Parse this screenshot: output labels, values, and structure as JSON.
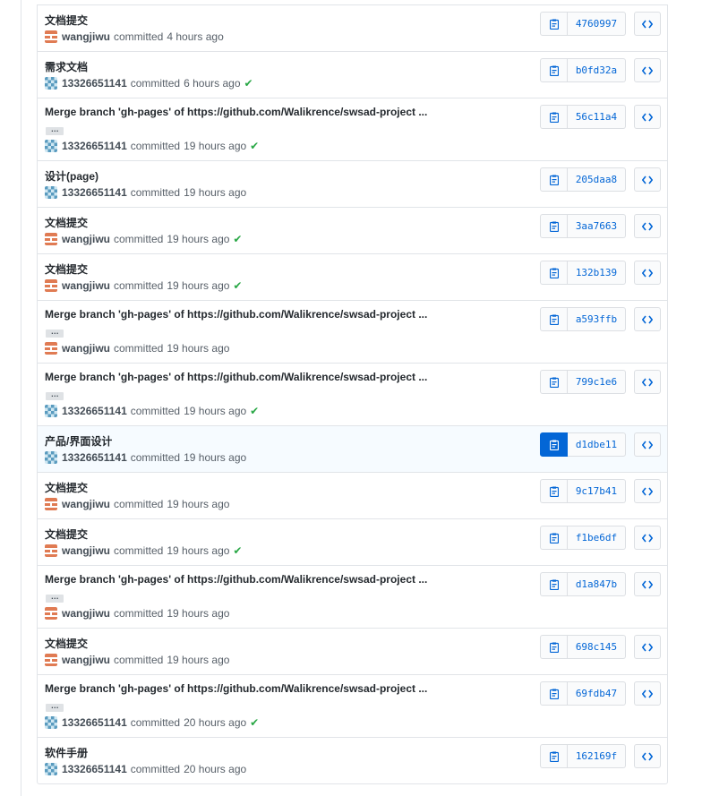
{
  "labels": {
    "committed": "committed"
  },
  "check_mark": "✔",
  "ellipsis": "…",
  "colors": {
    "link": "#0366d6",
    "success": "#28a745",
    "highlight_bg": "#f6fbff"
  },
  "commits": [
    {
      "message": "文档提交",
      "author": "wangjiwu",
      "avatar": "wangjiwu-avatar",
      "time": "4 hours ago",
      "status": "",
      "sha": "4760997",
      "expandable": false,
      "active": false
    },
    {
      "message": "需求文档",
      "author": "13326651141",
      "avatar": "13326651141-avatar",
      "time": "6 hours ago",
      "status": "success",
      "sha": "b0fd32a",
      "expandable": false,
      "active": false
    },
    {
      "message": "Merge branch 'gh-pages' of https://github.com/Walikrence/swsad-project ...",
      "author": "13326651141",
      "avatar": "13326651141-avatar",
      "time": "19 hours ago",
      "status": "success",
      "sha": "56c11a4",
      "expandable": true,
      "active": false
    },
    {
      "message": "设计(page)",
      "author": "13326651141",
      "avatar": "13326651141-avatar",
      "time": "19 hours ago",
      "status": "",
      "sha": "205daa8",
      "expandable": false,
      "active": false
    },
    {
      "message": "文档提交",
      "author": "wangjiwu",
      "avatar": "wangjiwu-avatar",
      "time": "19 hours ago",
      "status": "success",
      "sha": "3aa7663",
      "expandable": false,
      "active": false
    },
    {
      "message": "文档提交",
      "author": "wangjiwu",
      "avatar": "wangjiwu-avatar",
      "time": "19 hours ago",
      "status": "success",
      "sha": "132b139",
      "expandable": false,
      "active": false
    },
    {
      "message": "Merge branch 'gh-pages' of https://github.com/Walikrence/swsad-project ...",
      "author": "wangjiwu",
      "avatar": "wangjiwu-avatar",
      "time": "19 hours ago",
      "status": "",
      "sha": "a593ffb",
      "expandable": true,
      "active": false
    },
    {
      "message": "Merge branch 'gh-pages' of https://github.com/Walikrence/swsad-project ...",
      "author": "13326651141",
      "avatar": "13326651141-avatar",
      "time": "19 hours ago",
      "status": "success",
      "sha": "799c1e6",
      "expandable": true,
      "active": false
    },
    {
      "message": "产品/界面设计",
      "author": "13326651141",
      "avatar": "13326651141-avatar",
      "time": "19 hours ago",
      "status": "",
      "sha": "d1dbe11",
      "expandable": false,
      "active": true
    },
    {
      "message": "文档提交",
      "author": "wangjiwu",
      "avatar": "wangjiwu-avatar",
      "time": "19 hours ago",
      "status": "",
      "sha": "9c17b41",
      "expandable": false,
      "active": false
    },
    {
      "message": "文档提交",
      "author": "wangjiwu",
      "avatar": "wangjiwu-avatar",
      "time": "19 hours ago",
      "status": "success",
      "sha": "f1be6df",
      "expandable": false,
      "active": false
    },
    {
      "message": "Merge branch 'gh-pages' of https://github.com/Walikrence/swsad-project ...",
      "author": "wangjiwu",
      "avatar": "wangjiwu-avatar",
      "time": "19 hours ago",
      "status": "",
      "sha": "d1a847b",
      "expandable": true,
      "active": false
    },
    {
      "message": "文档提交",
      "author": "wangjiwu",
      "avatar": "wangjiwu-avatar",
      "time": "19 hours ago",
      "status": "",
      "sha": "698c145",
      "expandable": false,
      "active": false
    },
    {
      "message": "Merge branch 'gh-pages' of https://github.com/Walikrence/swsad-project ...",
      "author": "13326651141",
      "avatar": "13326651141-avatar",
      "time": "20 hours ago",
      "status": "success",
      "sha": "69fdb47",
      "expandable": true,
      "active": false
    },
    {
      "message": "软件手册",
      "author": "13326651141",
      "avatar": "13326651141-avatar",
      "time": "20 hours ago",
      "status": "",
      "sha": "162169f",
      "expandable": false,
      "active": false
    }
  ]
}
